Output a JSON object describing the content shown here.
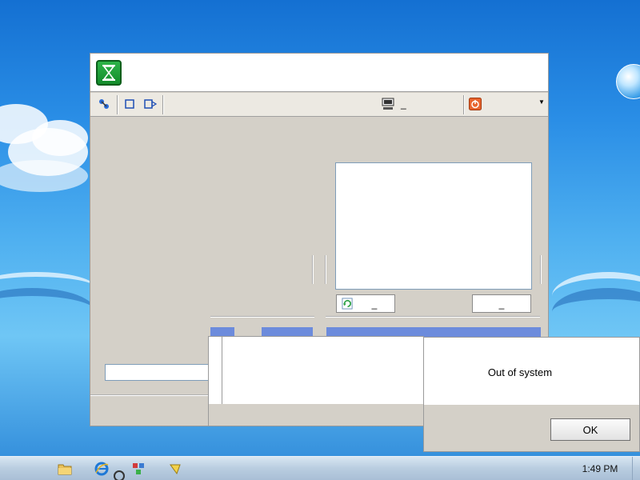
{
  "toolbar": {
    "monitor_label": "_",
    "dropdown_value": ""
  },
  "content": {
    "refresh_button_label": "_",
    "second_button_label": "_"
  },
  "dialog": {
    "message": "Out of system",
    "ok_label": "OK"
  },
  "taskbar": {
    "clock": "1:49 PM"
  },
  "colors": {
    "accent_blue": "#6c8bdc",
    "hourglass_green": "#1fa23a",
    "window_bg": "#d4d0c8"
  },
  "icons": [
    "hourglass-icon",
    "connect-icon",
    "stop-icon",
    "record-icon",
    "monitor-icon",
    "power-icon",
    "dropdown-arrow-icon",
    "refresh-icon",
    "folder-icon",
    "ie-icon",
    "network-icon",
    "pin-icon"
  ]
}
